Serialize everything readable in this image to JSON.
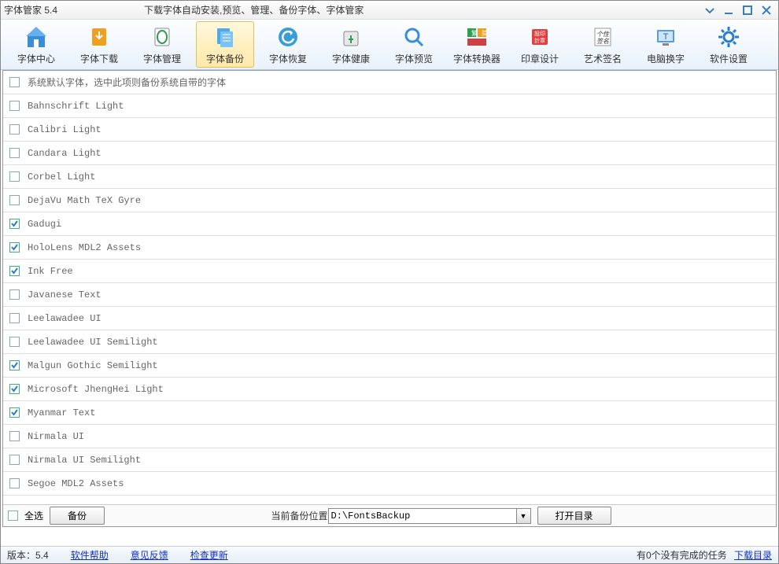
{
  "window": {
    "title": "字体管家 5.4",
    "subtitle": "下载字体自动安装,预览、管理、备份字体、字体管家"
  },
  "toolbar": [
    {
      "label": "字体中心",
      "icon": "home"
    },
    {
      "label": "字体下载",
      "icon": "download"
    },
    {
      "label": "字体管理",
      "icon": "manage"
    },
    {
      "label": "字体备份",
      "icon": "backup",
      "active": true
    },
    {
      "label": "字体恢复",
      "icon": "restore"
    },
    {
      "label": "字体健康",
      "icon": "health"
    },
    {
      "label": "字体预览",
      "icon": "preview"
    },
    {
      "label": "字体转换器",
      "icon": "convert"
    },
    {
      "label": "印章设计",
      "icon": "stamp"
    },
    {
      "label": "艺术签名",
      "icon": "signature"
    },
    {
      "label": "电脑换字",
      "icon": "computer-font"
    },
    {
      "label": "软件设置",
      "icon": "settings"
    }
  ],
  "fonts": [
    {
      "name": "系统默认字体，选中此项则备份系统自带的字体",
      "checked": false
    },
    {
      "name": "Bahnschrift Light",
      "checked": false
    },
    {
      "name": "Calibri Light",
      "checked": false
    },
    {
      "name": "Candara Light",
      "checked": false
    },
    {
      "name": "Corbel Light",
      "checked": false
    },
    {
      "name": "DejaVu Math TeX Gyre",
      "checked": false
    },
    {
      "name": "Gadugi",
      "checked": true
    },
    {
      "name": "HoloLens MDL2 Assets",
      "checked": true
    },
    {
      "name": "Ink Free",
      "checked": true
    },
    {
      "name": "Javanese Text",
      "checked": false
    },
    {
      "name": "Leelawadee UI",
      "checked": false
    },
    {
      "name": "Leelawadee UI Semilight",
      "checked": false
    },
    {
      "name": "Malgun Gothic Semilight",
      "checked": true
    },
    {
      "name": "Microsoft JhengHei Light",
      "checked": true
    },
    {
      "name": "Myanmar Text",
      "checked": true
    },
    {
      "name": "Nirmala UI",
      "checked": false
    },
    {
      "name": "Nirmala UI Semilight",
      "checked": false
    },
    {
      "name": "Segoe MDL2 Assets",
      "checked": false
    }
  ],
  "bottom": {
    "select_all": "全选",
    "backup_btn": "备份",
    "path_label": "当前备份位置",
    "path_value": "D:\\FontsBackup",
    "open_dir": "打开目录"
  },
  "status": {
    "version_label": "版本：5.4",
    "help": "软件帮助",
    "feedback": "意见反馈",
    "check_update": "检查更新",
    "right_text": "有0个没有完成的任务",
    "download_dir": "下载目录"
  }
}
